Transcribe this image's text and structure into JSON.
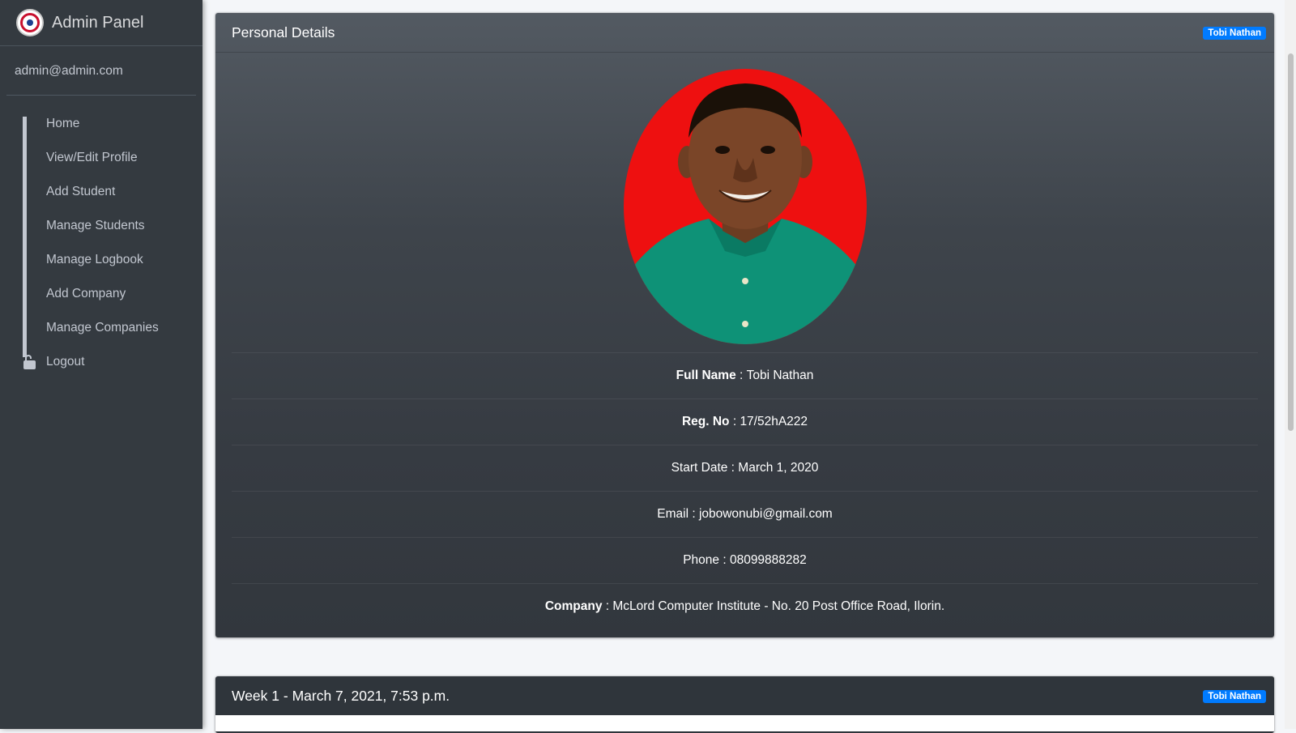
{
  "sidebar": {
    "brand": "Admin Panel",
    "user_email": "admin@admin.com",
    "items": [
      {
        "label": "Home",
        "icon": "grid-icon"
      },
      {
        "label": "View/Edit Profile",
        "icon": "grid-icon"
      },
      {
        "label": "Add Student",
        "icon": "grid-icon"
      },
      {
        "label": "Manage Students",
        "icon": "grid-icon"
      },
      {
        "label": "Manage Logbook",
        "icon": "grid-icon"
      },
      {
        "label": "Add Company",
        "icon": "grid-icon"
      },
      {
        "label": "Manage Companies",
        "icon": "grid-icon"
      },
      {
        "label": "Logout",
        "icon": "unlock-icon"
      }
    ]
  },
  "details": {
    "title": "Personal Details",
    "badge": "Tobi Nathan",
    "full_name_label": "Full Name",
    "full_name": "Tobi Nathan",
    "reg_label": "Reg. No",
    "reg_no": "17/52hA222",
    "start_label": "Start Date",
    "start_date": "March 1, 2020",
    "email_label": "Email",
    "email": "jobowonubi@gmail.com",
    "phone_label": "Phone",
    "phone": "08099888282",
    "company_label": "Company",
    "company": "McLord Computer Institute - No. 20 Post Office Road, Ilorin."
  },
  "week": {
    "title": "Week 1 - March 7, 2021, 7:53 p.m.",
    "badge": "Tobi Nathan"
  },
  "colors": {
    "sidebar": "#343a40",
    "accent_badge": "#007bff",
    "photo_background": "#ee1010"
  }
}
